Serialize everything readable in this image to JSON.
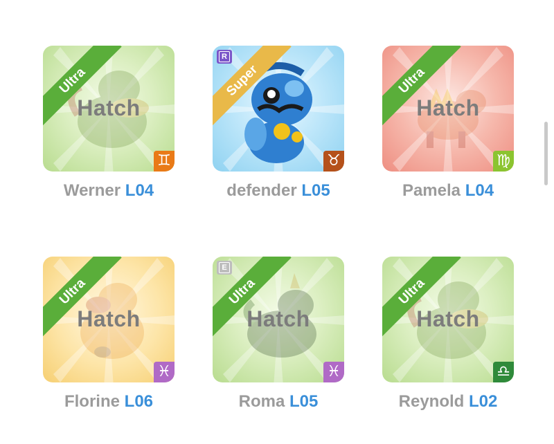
{
  "cards": [
    {
      "name": "Werner",
      "level": "L04",
      "rarity": "Ultra",
      "hatch": "Hatch",
      "color": "green",
      "zodiac_icon": "gemini-icon",
      "zodiac_glyph": "♊",
      "zodiac_color": "#e97a17",
      "badge": ""
    },
    {
      "name": "defender",
      "level": "L05",
      "rarity": "Super",
      "hatch": "",
      "color": "blue",
      "zodiac_icon": "taurus-icon",
      "zodiac_glyph": "♉",
      "zodiac_color": "#b5511a",
      "badge": "R",
      "badge_color": "#7b55c9"
    },
    {
      "name": "Pamela",
      "level": "L04",
      "rarity": "Ultra",
      "hatch": "Hatch",
      "color": "red",
      "zodiac_icon": "virgo-icon",
      "zodiac_glyph": "♍",
      "zodiac_color": "#8bc430",
      "badge": ""
    },
    {
      "name": "Florine",
      "level": "L06",
      "rarity": "Ultra",
      "hatch": "Hatch",
      "color": "yellow",
      "zodiac_icon": "pisces-icon",
      "zodiac_glyph": "♓",
      "zodiac_color": "#b06ac6",
      "badge": ""
    },
    {
      "name": "Roma",
      "level": "L05",
      "rarity": "Ultra",
      "hatch": "Hatch",
      "color": "green",
      "zodiac_icon": "pisces-icon",
      "zodiac_glyph": "♓",
      "zodiac_color": "#b06ac6",
      "badge": "E",
      "badge_color": "#bdbdbd"
    },
    {
      "name": "Reynold",
      "level": "L02",
      "rarity": "Ultra",
      "hatch": "Hatch",
      "color": "green",
      "zodiac_icon": "libra-icon",
      "zodiac_glyph": "♎",
      "zodiac_color": "#2f8a3a",
      "badge": ""
    }
  ]
}
